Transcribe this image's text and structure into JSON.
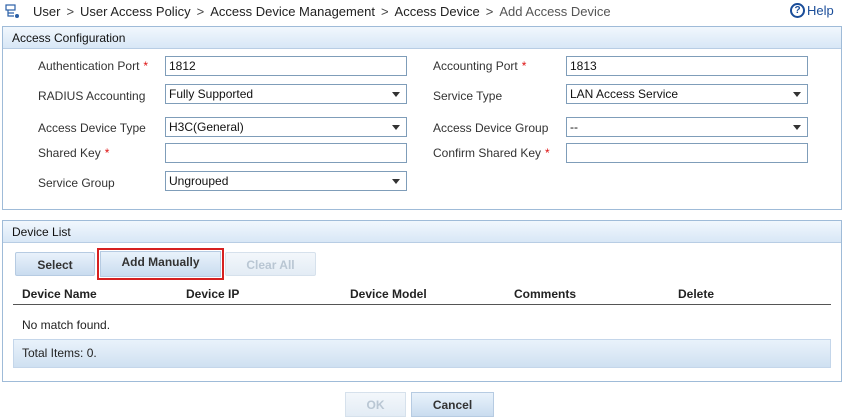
{
  "breadcrumb": {
    "items": [
      "User",
      "User Access Policy",
      "Access Device Management",
      "Access Device",
      "Add Access Device"
    ],
    "separator": ">"
  },
  "help": {
    "label": "Help"
  },
  "access_config": {
    "title": "Access Configuration",
    "fields": {
      "auth_port": {
        "label": "Authentication Port",
        "required": "*",
        "value": "1812"
      },
      "acct_port": {
        "label": "Accounting Port",
        "required": "*",
        "value": "1813"
      },
      "radius_accounting": {
        "label": "RADIUS Accounting",
        "value": "Fully Supported"
      },
      "service_type": {
        "label": "Service Type",
        "value": "LAN Access Service"
      },
      "device_type": {
        "label": "Access Device Type",
        "value": "H3C(General)"
      },
      "device_group": {
        "label": "Access Device Group",
        "value": "--"
      },
      "shared_key": {
        "label": "Shared Key",
        "required": "*",
        "value": ""
      },
      "confirm_key": {
        "label": "Confirm Shared Key",
        "required": "*",
        "value": ""
      },
      "service_group": {
        "label": "Service Group",
        "value": "Ungrouped"
      }
    }
  },
  "device_list": {
    "title": "Device List",
    "toolbar": {
      "select": "Select",
      "add_manually": "Add Manually",
      "clear_all": "Clear All"
    },
    "columns": [
      "Device Name",
      "Device IP",
      "Device Model",
      "Comments",
      "Delete"
    ],
    "empty_message": "No match found.",
    "total": "Total Items: 0."
  },
  "actions": {
    "ok": "OK",
    "cancel": "Cancel"
  },
  "colors": {
    "accent": "#1a4d99",
    "required": "#dd1111",
    "highlight": "#d62020"
  }
}
